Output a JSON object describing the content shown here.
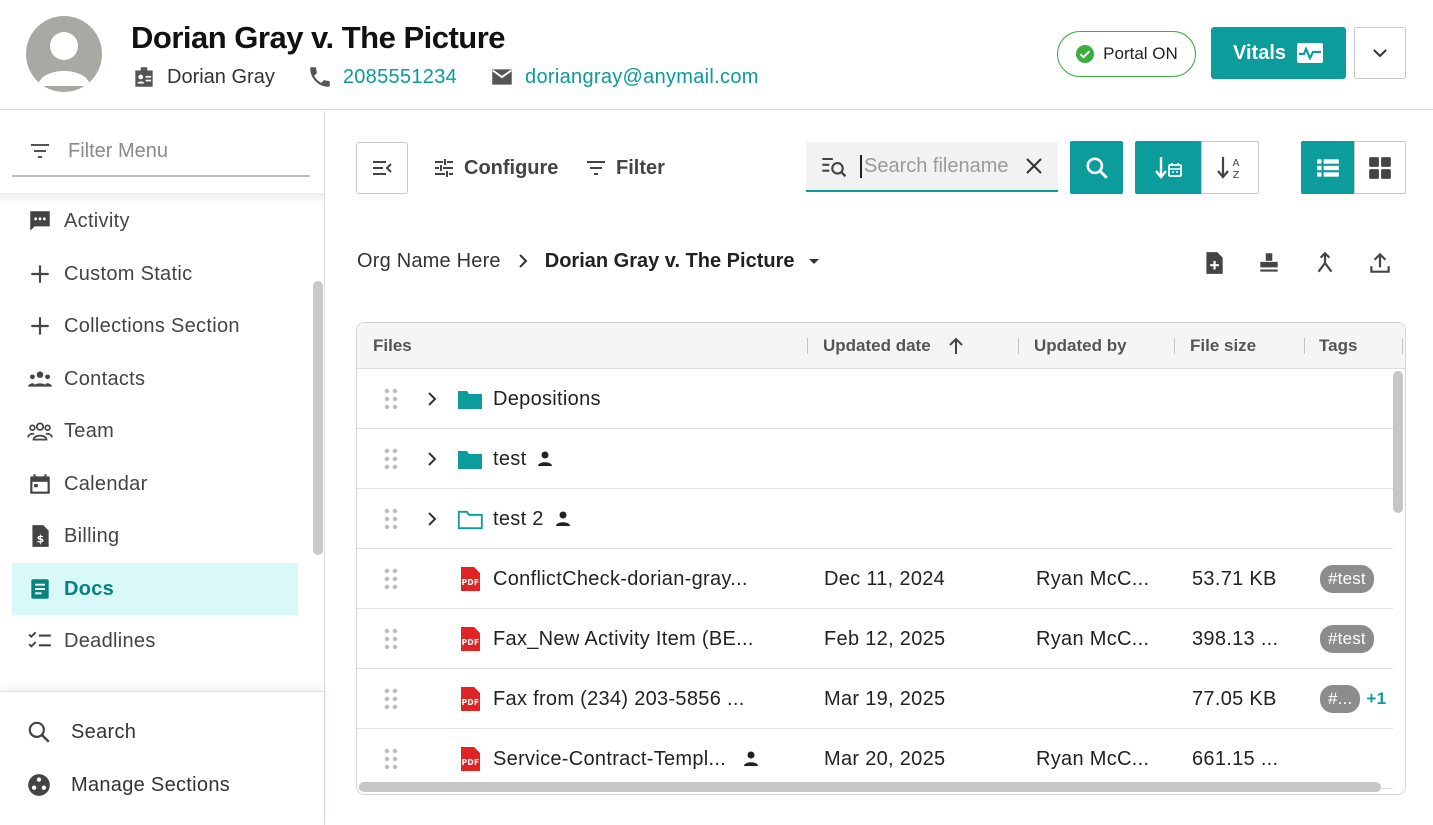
{
  "header": {
    "title": "Dorian Gray v. The Picture",
    "client_name": "Dorian Gray",
    "phone": "2085551234",
    "email": "doriangray@anymail.com",
    "portal_label": "Portal ON",
    "vitals_label": "Vitals",
    "icons": [
      "avatar",
      "client-badge-icon",
      "phone-icon",
      "email-icon",
      "check-circle-icon",
      "vitals-icon",
      "chevron-down-icon"
    ]
  },
  "sidebar": {
    "filter_placeholder": "Filter Menu",
    "items": [
      {
        "label": "Activity",
        "icon": "chat-icon",
        "active": false
      },
      {
        "label": "Custom Static",
        "icon": "plus-icon",
        "active": false
      },
      {
        "label": "Collections Section",
        "icon": "plus-icon",
        "active": false
      },
      {
        "label": "Contacts",
        "icon": "contacts-icon",
        "active": false
      },
      {
        "label": "Team",
        "icon": "team-icon",
        "active": false
      },
      {
        "label": "Calendar",
        "icon": "calendar-icon",
        "active": false
      },
      {
        "label": "Billing",
        "icon": "billing-icon",
        "active": false
      },
      {
        "label": "Docs",
        "icon": "docs-icon",
        "active": true
      },
      {
        "label": "Deadlines",
        "icon": "checklist-icon",
        "active": false
      }
    ],
    "bottom": {
      "search_label": "Search",
      "manage_label": "Manage Sections"
    }
  },
  "toolbar": {
    "configure_label": "Configure",
    "filter_label": "Filter",
    "search_placeholder": "Search filename",
    "search_value": ""
  },
  "breadcrumb": {
    "org": "Org Name Here",
    "current": "Dorian Gray v. The Picture"
  },
  "table": {
    "columns": [
      "Files",
      "Updated date",
      "Updated by",
      "File size",
      "Tags"
    ],
    "sort_column": "Updated date",
    "sort_direction": "ascending",
    "rows": [
      {
        "type": "folder",
        "name": "Depositions",
        "shared": false,
        "date": "",
        "by": "",
        "size": "",
        "tag": "",
        "more": ""
      },
      {
        "type": "folder",
        "name": "test",
        "shared": true,
        "date": "",
        "by": "",
        "size": "",
        "tag": "",
        "more": ""
      },
      {
        "type": "folder-outline",
        "name": "test 2",
        "shared": true,
        "date": "",
        "by": "",
        "size": "",
        "tag": "",
        "more": ""
      },
      {
        "type": "pdf",
        "name": "ConflictCheck-dorian-gray...",
        "shared": false,
        "date": "Dec 11, 2024",
        "by": "Ryan McC...",
        "size": "53.71 KB",
        "tag": "#test",
        "more": ""
      },
      {
        "type": "pdf",
        "name": "Fax_New Activity Item (BE...",
        "shared": false,
        "date": "Feb 12, 2025",
        "by": "Ryan McC...",
        "size": "398.13 ...",
        "tag": "#test",
        "more": ""
      },
      {
        "type": "pdf",
        "name": "Fax from (234) 203-5856 ...",
        "shared": false,
        "date": "Mar 19, 2025",
        "by": "",
        "size": "77.05 KB",
        "tag": "#...",
        "more": "+1"
      },
      {
        "type": "pdf",
        "name": "Service-Contract-Templ...",
        "shared": true,
        "date": "Mar 20, 2025",
        "by": "Ryan McC...",
        "size": "661.15 ...",
        "tag": "",
        "more": ""
      }
    ]
  },
  "colors": {
    "accent": "#0c9c9c",
    "active_nav_bg": "#d9f8f8",
    "portal_green": "#3cae3f",
    "pdf_red": "#e02424",
    "tag_gray": "#8c8c8c"
  }
}
